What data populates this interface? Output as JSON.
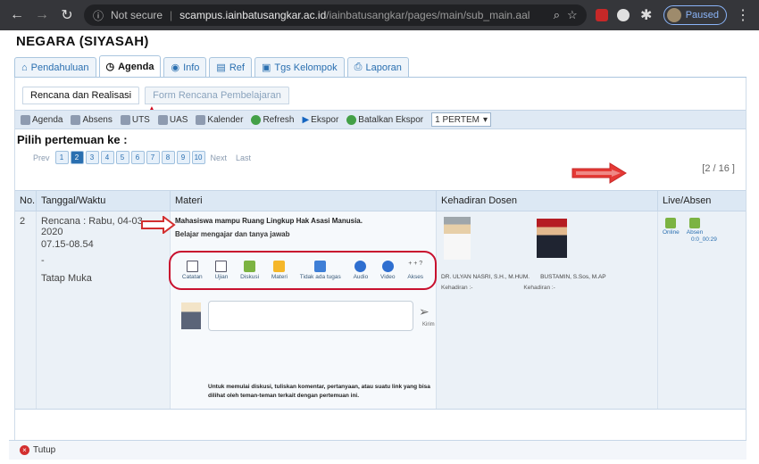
{
  "browser": {
    "security_label": "Not secure",
    "separator": "|",
    "host": "scampus.iainbatusangkar.ac.id",
    "path": "/iainbatusangkar/pages/main/sub_main.aal",
    "profile_label": "Paused"
  },
  "course": {
    "title": "NEGARA (SIYASAH)"
  },
  "tabs": [
    {
      "label": "Pendahuluan",
      "icon": "home-icon"
    },
    {
      "label": "Agenda",
      "icon": "clock-icon"
    },
    {
      "label": "Info",
      "icon": "globe-icon"
    },
    {
      "label": "Ref",
      "icon": "book-icon"
    },
    {
      "label": "Tgs Kelompok",
      "icon": "group-icon"
    },
    {
      "label": "Laporan",
      "icon": "printer-icon"
    }
  ],
  "subtabs": [
    {
      "label": "Rencana dan Realisasi"
    },
    {
      "label": "Form Rencana Pembelajaran"
    }
  ],
  "toolbar": {
    "items": [
      "Agenda",
      "Absens",
      "UTS",
      "UAS",
      "Kalender",
      "Refresh",
      "Ekspor",
      "Batalkan Ekspor"
    ],
    "select_value": "1 PERTEM"
  },
  "heading": "Pilih pertemuan ke :",
  "pager": {
    "prev": "Prev",
    "pages": [
      "1",
      "2",
      "3",
      "4",
      "5",
      "6",
      "7",
      "8",
      "9",
      "10"
    ],
    "next": "Next",
    "last": "Last",
    "count": "[2 / 16 ]"
  },
  "table": {
    "headers": [
      "No.",
      "Tanggal/Waktu",
      "Materi",
      "Kehadiran Dosen",
      "Live/Absen"
    ],
    "row": {
      "no": "2",
      "date_line1": "Rencana : Rabu, 04-03-2020",
      "date_line2": "07.15-08.54",
      "date_line3": "-",
      "mode": "Tatap Muka",
      "materi_title": "Mahasiswa mampu Ruang Lingkup Hak Asasi Manusia.",
      "materi_sub": "Belajar mengajar dan tanya jawab",
      "tools": [
        {
          "label": "Catatan"
        },
        {
          "label": "Ujian"
        },
        {
          "label": "Diskusi"
        },
        {
          "label": "Materi"
        },
        {
          "label": "Tidak ada tugas"
        },
        {
          "label": "Audio"
        },
        {
          "label": "Video"
        },
        {
          "label": "Akses"
        }
      ],
      "tools_badge": "+ + ?",
      "kirim_label": "Kirim",
      "note": "Untuk memulai diskusi, tuliskan komentar, pertanyaan, atau suatu link yang bisa dilihat oleh teman-teman terkait dengan pertemuan ini.",
      "dosen": [
        {
          "name": "DR. ULYAN NASRI, S.H., M.HUM.",
          "status": "Kehadiran :-"
        },
        {
          "name": "BUSTAMIN, S.Sos, M.AP",
          "status": "Kehadiran :-"
        }
      ],
      "live": {
        "online_label": "Online",
        "absen_label": "Absen",
        "time": "0:0_00:29"
      }
    }
  },
  "bottom": {
    "close_label": "Tutup"
  }
}
